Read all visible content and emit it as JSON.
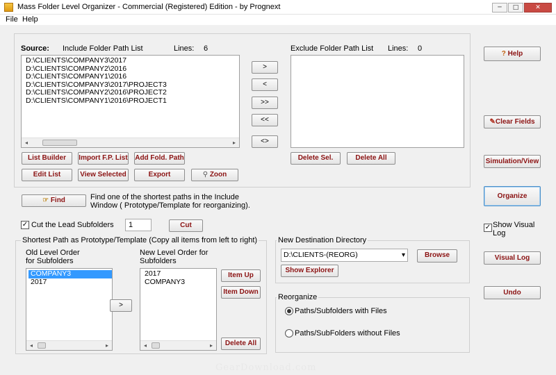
{
  "window": {
    "title": "Mass Folder Level Organizer - Commercial (Registered) Edition - by Prognext",
    "min": "─",
    "max": "□",
    "close": "✕"
  },
  "menu": [
    "File",
    "Help"
  ],
  "source": {
    "label": "Source:",
    "include_label": "Include Folder Path List",
    "lines_label": "Lines:",
    "lines_count": "6",
    "include_items": [
      "D:\\CLIENTS\\COMPANY3\\2017",
      "D:\\CLIENTS\\COMPANY2\\2016",
      "D:\\CLIENTS\\COMPANY1\\2016",
      "D:\\CLIENTS\\COMPANY3\\2017\\PROJECT3",
      "D:\\CLIENTS\\COMPANY2\\2016\\PROJECT2",
      "D:\\CLIENTS\\COMPANY1\\2016\\PROJECT1"
    ],
    "exclude_label": "Exclude Folder Path List",
    "exclude_lines_label": "Lines:",
    "exclude_lines_count": "0"
  },
  "move_buttons": {
    "one_right": ">",
    "one_left": "<",
    "all_right": ">>",
    "all_left": "<<",
    "swap": "<>"
  },
  "buttons": {
    "list_builder": "List Builder",
    "import_fp_list": "Import F.P. List",
    "add_fold_path": "Add Fold. Path",
    "edit_list": "Edit List",
    "view_selected": "View Selected",
    "export": "Export",
    "zoon": "Zoon",
    "delete_sel": "Delete Sel.",
    "delete_all": "Delete All",
    "find": "Find",
    "cut": "Cut",
    "level_right": ">",
    "item_up": "Item Up",
    "item_down": "Item Down",
    "delete_all_level": "Delete All",
    "browse": "Browse",
    "show_explorer": "Show Explorer",
    "help": "Help",
    "clear_fields": "Clear Fields",
    "simulation_view": "Simulation/View",
    "organize": "Organize",
    "visual_log": "Visual Log",
    "undo": "Undo"
  },
  "find_desc_1": "Find one of the shortest paths in the Include",
  "find_desc_2": "Window ( Prototype/Template for reorganizing).",
  "cut_lead": {
    "label": "Cut the Lead Subfolders",
    "checked": true,
    "value": "1"
  },
  "prototype": {
    "title": "Shortest Path as Prototype/Template (Copy all items from left to right)",
    "old_label_1": "Old Level Order",
    "old_label_2": "for Subfolders",
    "old_items": [
      "COMPANY3",
      "2017"
    ],
    "new_label_1": "New Level Order for",
    "new_label_2": "Subfolders",
    "new_items": [
      "2017",
      "COMPANY3"
    ]
  },
  "destination": {
    "title": "New Destination  Directory",
    "value": "D:\\CLIENTS-(REORG)"
  },
  "reorganize": {
    "title": "Reorganize",
    "option_with": "Paths/Subfolders with Files",
    "option_without": "Paths/SubFolders without Files",
    "selected": "with"
  },
  "show_visual_log": {
    "label_1": "Show Visual",
    "label_2": "Log",
    "checked": true
  },
  "watermark": "GearDownload.com",
  "icons": {
    "check": "✓",
    "help": "?",
    "dropdown": "▾",
    "left_arrow": "◂",
    "right_arrow": "▸"
  }
}
